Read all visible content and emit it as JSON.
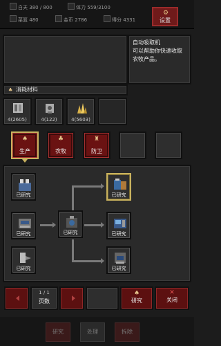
{
  "top_stats": {
    "day_label": "白天",
    "day_value": "380 / 800",
    "stamina_label": "体力",
    "stamina_value": "559/3100",
    "food_label": "菜篮",
    "food_value": "480",
    "gold_label": "金币",
    "gold_value": "2786",
    "score_label": "得分",
    "score_value": "4331"
  },
  "settings_label": "设置",
  "description": "自动吸取机\n可以帮助你快速收取农牧产品。",
  "materials": {
    "header": "消耗材料",
    "items": [
      {
        "count": "4(2605)",
        "icon": "book-icon"
      },
      {
        "count": "4(122)",
        "icon": "machine-icon"
      },
      {
        "count": "4(5603)",
        "icon": "gold-crystal-icon"
      }
    ]
  },
  "categories": [
    {
      "label": "生产",
      "icon": "production-icon",
      "active": true
    },
    {
      "label": "农牧",
      "icon": "farm-icon",
      "active": false
    },
    {
      "label": "防卫",
      "icon": "defense-icon",
      "active": false
    }
  ],
  "tech_nodes": {
    "status_label": "已研究"
  },
  "pager": {
    "value": "1 / 1",
    "label": "页数"
  },
  "buttons": {
    "research": "研究",
    "close": "关闭"
  },
  "bottom_tabs": [
    "研究",
    "处理",
    "拆除"
  ],
  "colors": {
    "accent_red": "#6a1212",
    "selected_gold": "#c9b25e",
    "background": "#1c1c1c"
  }
}
